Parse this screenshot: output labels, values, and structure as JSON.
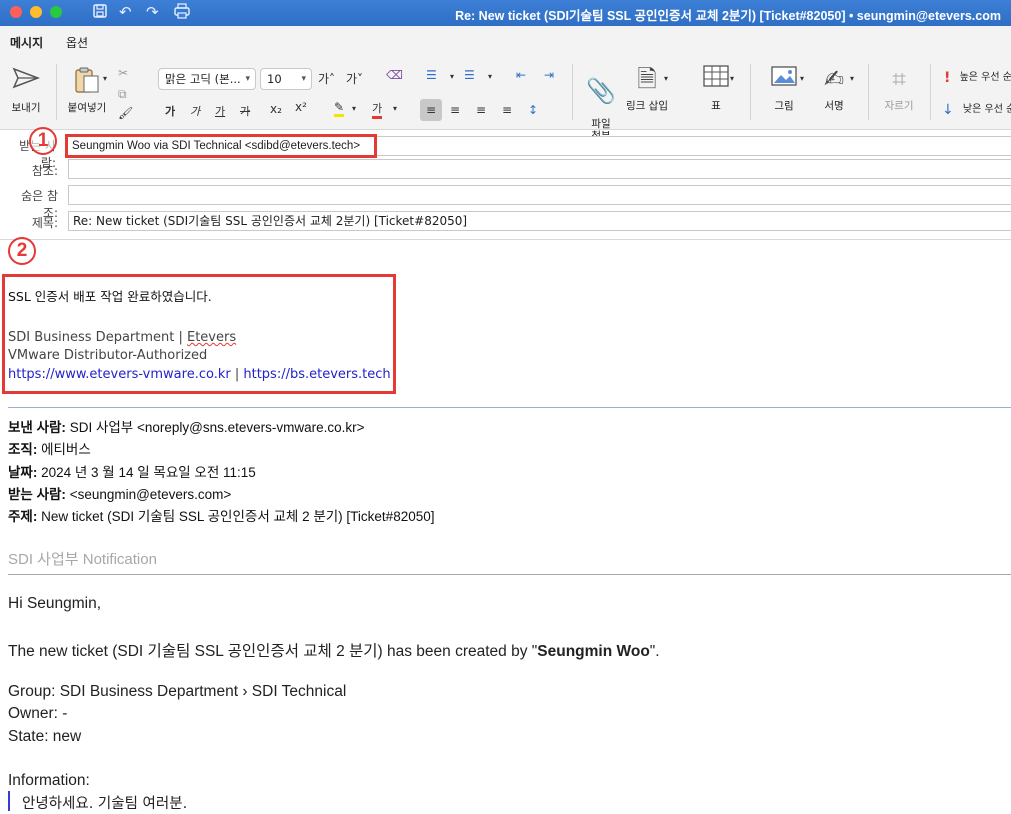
{
  "window": {
    "title": "Re: New ticket (SDI기술팀 SSL 공인인증서 교체 2분기) [Ticket#82050] • seungmin@etevers.com"
  },
  "tabs": [
    "메시지",
    "옵션"
  ],
  "ribbon": {
    "send": "보내기",
    "paste": "붙여넣기",
    "font_name": "맑은 고딕 (본...",
    "font_size": "10",
    "grow_font": "가˄",
    "shrink_font": "가˅",
    "bold": "가",
    "italic": "가",
    "underline": "가",
    "strike": "가",
    "subscript": "x₂",
    "superscript": "x²",
    "font_color": "가",
    "attach_file": "파일\n첨부",
    "insert_link": "링크 삽입",
    "table": "표",
    "picture": "그림",
    "signature": "서명",
    "crop": "자르기",
    "high_priority": "높은 우선 순",
    "low_priority": "낮은 우선 순"
  },
  "header": {
    "to_label": "받는 사람:",
    "to_value": "Seungmin Woo via SDI Technical <sdibd@etevers.tech>",
    "cc_label": "참조:",
    "bcc_label": "숨은 참조:",
    "subject_label": "제목:",
    "subject_value": "Re: New ticket (SDI기술팀 SSL 공인인증서 교체 2분기) [Ticket#82050]"
  },
  "annotations": {
    "marker1": "1",
    "marker2": "2"
  },
  "reply": {
    "text": "SSL 인증서 배포 작업 완료하였습니다.",
    "sig_line1_prefix": "SDI Business Department | ",
    "sig_line1_brand": "Etevers",
    "sig_line2": "VMware Distributor-Authorized",
    "sig_link1": "https://www.etevers-vmware.co.kr",
    "sig_link_sep": " | ",
    "sig_link2": "https://bs.etevers.tech"
  },
  "original": {
    "from_label": "보낸 사람:",
    "from_value": " SDI 사업부 <noreply@sns.etevers-vmware.co.kr>",
    "org_label": "조직:",
    "org_value": " 에티버스",
    "date_label": "날짜:",
    "date_value": " 2024 년 3 월 14 일 목요일 오전 11:15",
    "to_label": "받는 사람:",
    "to_value": " <seungmin@etevers.com>",
    "subject_label": "주제:",
    "subject_value": " New ticket (SDI 기술팀 SSL 공인인증서 교체 2 분기) [Ticket#82050]"
  },
  "notification": {
    "heading": "SDI 사업부 Notification",
    "greeting": "Hi Seungmin,",
    "created_prefix": "The new ticket (SDI 기술팀 SSL 공인인증서 교체 2 분기) has been created by \"",
    "created_by": "Seungmin Woo",
    "created_suffix": "\".",
    "group": "Group: SDI Business Department › SDI Technical",
    "owner": "Owner: -",
    "state": "State: new",
    "information_label": "Information:",
    "quote": "안녕하세요. 기술팀 여러분."
  }
}
